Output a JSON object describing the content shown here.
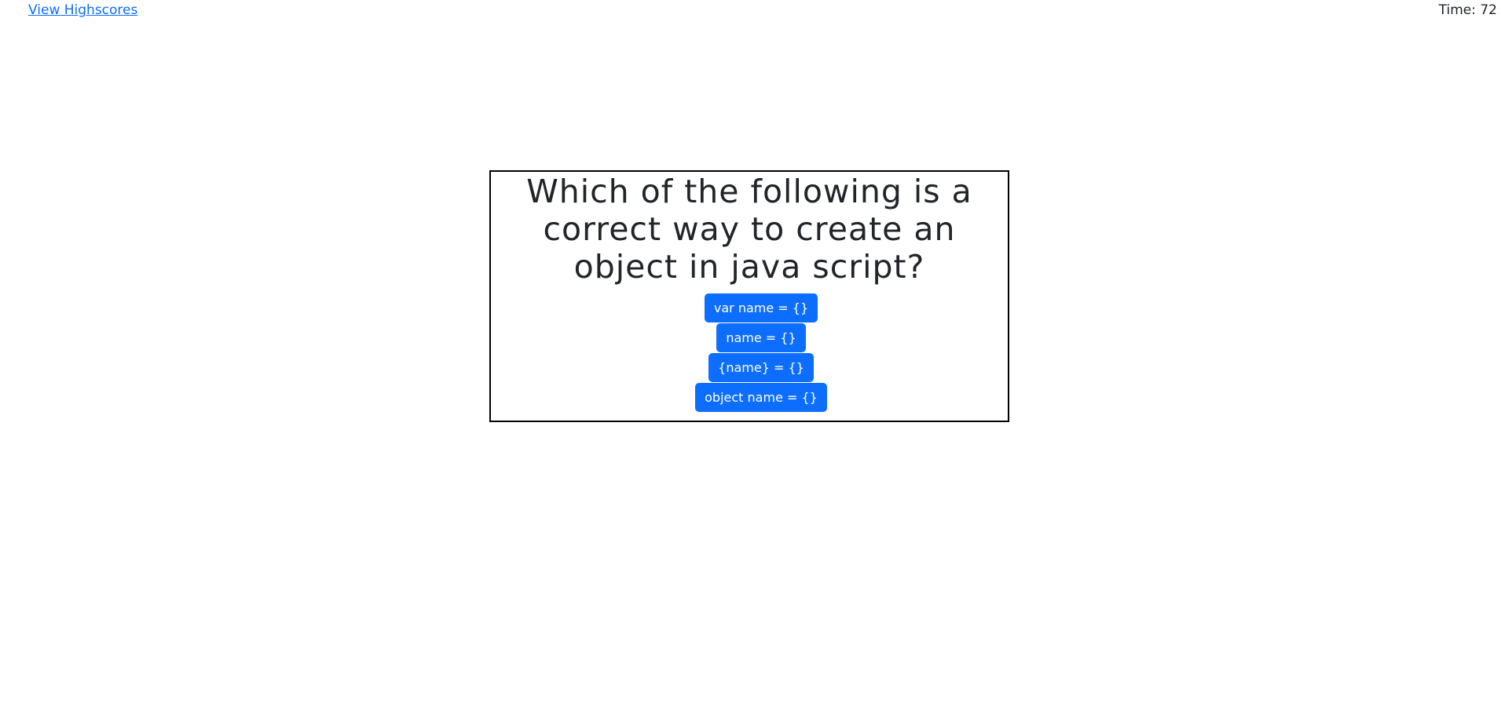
{
  "header": {
    "highscores_label": "View Highscores",
    "timer_label": "Time:",
    "timer_value": "72"
  },
  "quiz": {
    "question": "Which of the following is a correct way to create an object in java script?",
    "choices": [
      "var name = {}",
      "name = {}",
      "{name} = {}",
      "object name = {}"
    ]
  },
  "colors": {
    "button_bg": "#0d6efd",
    "button_text": "#ffffff",
    "link": "#0d6efd",
    "box_border": "#000000"
  }
}
